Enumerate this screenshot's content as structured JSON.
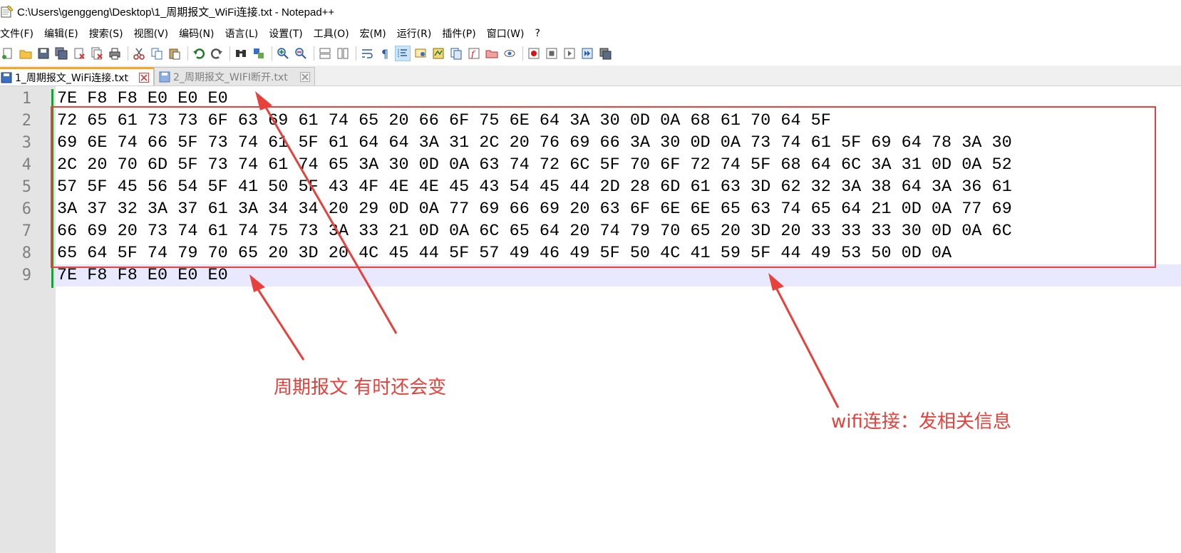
{
  "window": {
    "title": "C:\\Users\\genggeng\\Desktop\\1_周期报文_WiFi连接.txt - Notepad++"
  },
  "menu": [
    "文件(F)",
    "编辑(E)",
    "搜索(S)",
    "视图(V)",
    "编码(N)",
    "语言(L)",
    "设置(T)",
    "工具(O)",
    "宏(M)",
    "运行(R)",
    "插件(P)",
    "窗口(W)",
    "?"
  ],
  "toolbar": {
    "icons": [
      "new-file-icon",
      "open-file-icon",
      "save-icon",
      "save-all-icon",
      "close-icon",
      "close-all-icon",
      "print-icon",
      "cut-icon",
      "copy-icon",
      "paste-icon",
      "undo-icon",
      "redo-icon",
      "find-icon",
      "replace-icon",
      "zoom-in-icon",
      "zoom-out-icon",
      "sync-vertical-icon",
      "sync-horizontal-icon",
      "word-wrap-icon",
      "show-all-chars-icon",
      "indent-guide-icon",
      "user-language-icon",
      "doc-map-icon",
      "function-list-icon",
      "folder-workspace-icon",
      "monitoring-icon",
      "eye-icon",
      "macro-record-icon",
      "macro-stop-icon",
      "macro-play-icon",
      "macro-run-multiple-icon",
      "macro-save-icon"
    ]
  },
  "tabs": [
    {
      "label": "1_周期报文_WiFi连接.txt",
      "active": true
    },
    {
      "label": "2_周期报文_WIFI断开.txt",
      "active": false
    }
  ],
  "editor": {
    "lines": [
      "7E F8 F8 E0 E0 E0",
      "72 65 61 73 73 6F 63 69 61 74 65 20 66 6F 75 6E 64 3A 30 0D 0A 68 61 70 64 5F",
      "69 6E 74 66 5F 73 74 61 5F 61 64 64 3A 31 2C 20 76 69 66 3A 30 0D 0A 73 74 61 5F 69 64 78 3A 30",
      "2C 20 70 6D 5F 73 74 61 74 65 3A 30 0D 0A 63 74 72 6C 5F 70 6F 72 74 5F 68 64 6C 3A 31 0D 0A 52",
      "57 5F 45 56 54 5F 41 50 5F 43 4F 4E 4E 45 43 54 45 44 2D 28 6D 61 63 3D 62 32 3A 38 64 3A 36 61",
      "3A 37 32 3A 37 61 3A 34 34 20 29 0D 0A 77 69 66 69 20 63 6F 6E 6E 65 63 74 65 64 21 0D 0A 77 69",
      "66 69 20 73 74 61 74 75 73 3A 33 21 0D 0A 6C 65 64 20 74 79 70 65 20 3D 20 33 33 33 30 0D 0A 6C",
      "65 64 5F 74 79 70 65 20 3D 20 4C 45 44 5F 57 49 46 49 5F 50 4C 41 59 5F 44 49 53 50 0D 0A",
      "7E F8 F8 E0 E0 E0"
    ],
    "line_numbers": [
      "1",
      "2",
      "3",
      "4",
      "5",
      "6",
      "7",
      "8",
      "9"
    ],
    "current_line": 9
  },
  "annotations": {
    "periodic_message": "周期报文 有时还会变",
    "wifi_connect": "wifi连接：发相关信息",
    "color": "#e8403a"
  }
}
